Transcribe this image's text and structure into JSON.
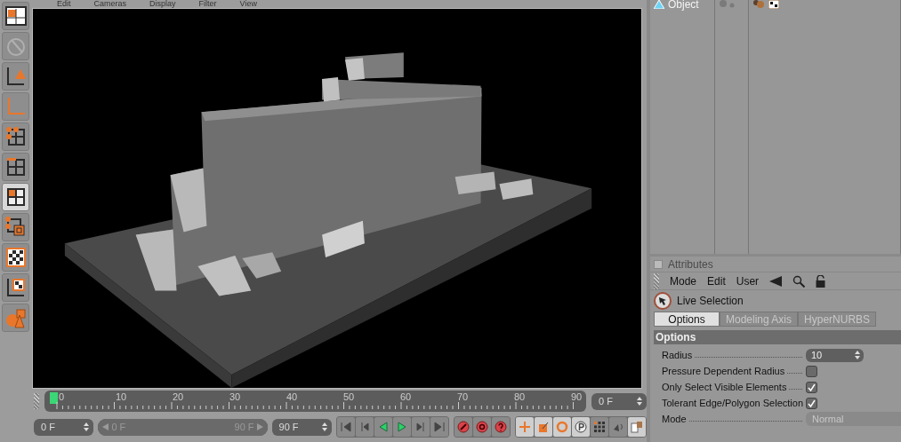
{
  "viewport": {
    "menu": [
      "Edit",
      "Cameras",
      "Display",
      "Filter",
      "View"
    ]
  },
  "tools": [
    {
      "kind": "layout",
      "selected": false
    },
    {
      "kind": "disabled",
      "selected": false
    },
    {
      "kind": "axis-cone",
      "selected": false
    },
    {
      "kind": "axis",
      "selected": false
    },
    {
      "kind": "points",
      "selected": false
    },
    {
      "kind": "edges",
      "selected": false
    },
    {
      "kind": "polygons",
      "selected": true
    },
    {
      "kind": "uv",
      "selected": false
    },
    {
      "kind": "texture",
      "selected": false
    },
    {
      "kind": "texture-axis",
      "selected": false
    },
    {
      "kind": "primitives",
      "selected": false
    }
  ],
  "object_manager": {
    "objects": [
      {
        "name": "Object"
      }
    ]
  },
  "attributes": {
    "title": "Attributes",
    "menu": [
      "Mode",
      "Edit",
      "User"
    ],
    "tool": "Live Selection",
    "tabs": [
      {
        "label": "Options",
        "selected": true
      },
      {
        "label": "Modeling Axis",
        "selected": false
      },
      {
        "label": "HyperNURBS",
        "selected": false
      }
    ],
    "section": "Options",
    "fields": [
      {
        "kind": "number",
        "label": "Radius",
        "value": "10"
      },
      {
        "kind": "checkbox",
        "label": "Pressure Dependent Radius",
        "checked": false
      },
      {
        "kind": "checkbox",
        "label": "Only Select Visible Elements",
        "checked": true
      },
      {
        "kind": "checkbox",
        "label": "Tolerant Edge/Polygon Selection",
        "checked": true
      },
      {
        "kind": "dropdown",
        "label": "Mode",
        "value": "Normal"
      }
    ]
  },
  "timeline": {
    "ticks": [
      "0",
      "10",
      "20",
      "30",
      "40",
      "50",
      "60",
      "70",
      "80",
      "90"
    ],
    "current_frame": "0 F"
  },
  "transport": {
    "start": "0 F",
    "range_start": "0 F",
    "range_end": "90 F",
    "end": "90 F",
    "range": {
      "level": 1
    }
  }
}
